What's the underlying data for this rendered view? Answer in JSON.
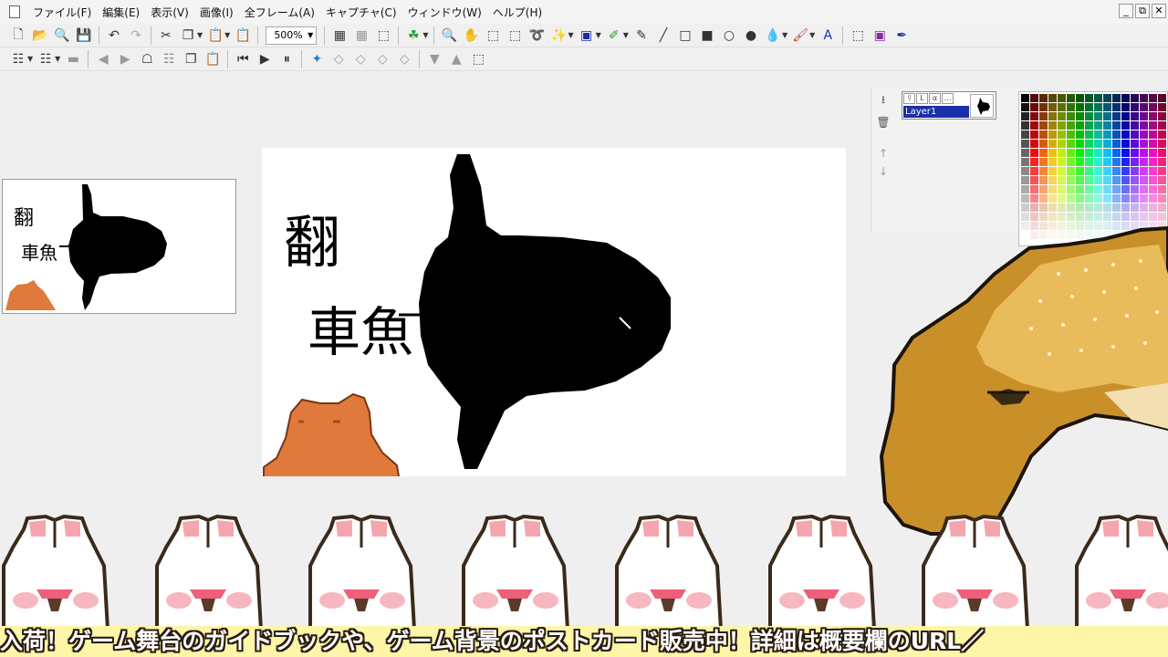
{
  "window": {
    "menu": [
      "ファイル(F)",
      "編集(E)",
      "表示(V)",
      "画像(I)",
      "全フレーム(A)",
      "キャプチャ(C)",
      "ウィンドウ(W)",
      "ヘルプ(H)"
    ],
    "controls": [
      "_",
      "⧉",
      "✕"
    ]
  },
  "toolbar": {
    "zoom": "500%"
  },
  "layers": {
    "flags": [
      "ﾘ",
      "L",
      "α",
      "…"
    ],
    "items": [
      {
        "name": "Layer1"
      }
    ]
  },
  "canvas": {
    "kanji_top": "翻",
    "kanji_bottom": "車魚"
  },
  "colors": {
    "accent": "#1a2fa8",
    "canvas_bg": "#ffffff",
    "banner_bg": "#fdf5a8",
    "fish": "#000000",
    "octopus": "#e07a3c",
    "cuttlefish": "#c9902a"
  },
  "banner": {
    "text": "入荷！ゲーム舞台のガイドブックや、ゲーム背景のポストカード販売中！詳細は概要欄のURL／"
  }
}
